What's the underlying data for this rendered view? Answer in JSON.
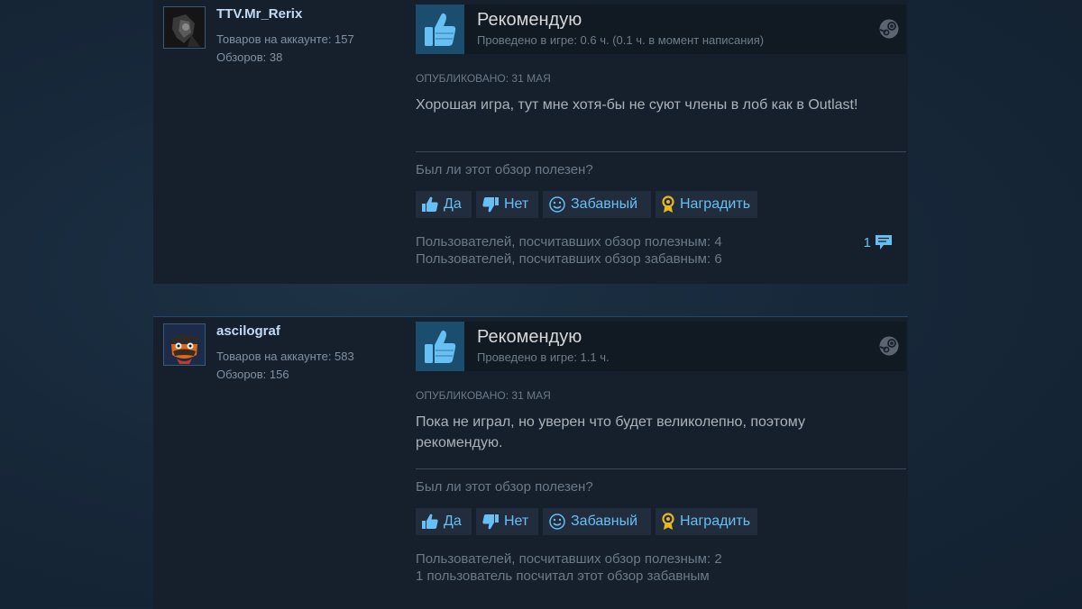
{
  "colors": {
    "accent": "#66c0f4",
    "panel": "#16202d",
    "button_bg": "#212c3d",
    "thumb_box": "#1b4d6f"
  },
  "vote_buttons": {
    "yes_label": "Да",
    "no_label": "Нет",
    "funny_label": "Забавный",
    "award_label": "Наградить"
  },
  "reviews": [
    {
      "author": {
        "name": "TTV.Mr_Rerix",
        "products": "Товаров на аккаунте: 157",
        "reviews": "Обзоров: 38"
      },
      "recommendation": "Рекомендую",
      "playtime": "Проведено в игре: 0.6 ч. (0.1 ч. в момент написания)",
      "posted": "ОПУБЛИКОВАНО: 31 МАЯ",
      "text": "Хорошая игра, тут мне хотя-бы не суют члены в лоб как в Outlast!",
      "helpful_question": "Был ли этот обзор полезен?",
      "helpful_count": "Пользователей, посчитавших обзор полезным: 4",
      "funny_count": "Пользователей, посчитавших обзор забавным: 6",
      "comments": "1",
      "icons": [
        "thumbs-up-icon",
        "steam-icon",
        "comment-icon"
      ]
    },
    {
      "author": {
        "name": "ascilograf",
        "products": "Товаров на аккаунте: 583",
        "reviews": "Обзоров: 156"
      },
      "recommendation": "Рекомендую",
      "playtime": "Проведено в игре: 1.1 ч.",
      "posted": "ОПУБЛИКОВАНО: 31 МАЯ",
      "text": "Пока не играл, но уверен что будет великолепно, поэтому рекомендую.",
      "helpful_question": "Был ли этот обзор полезен?",
      "helpful_count": "Пользователей, посчитавших обзор полезным: 2",
      "funny_count": "1 пользователь посчитал этот обзор забавным",
      "icons": [
        "thumbs-up-icon",
        "steam-icon"
      ]
    }
  ]
}
